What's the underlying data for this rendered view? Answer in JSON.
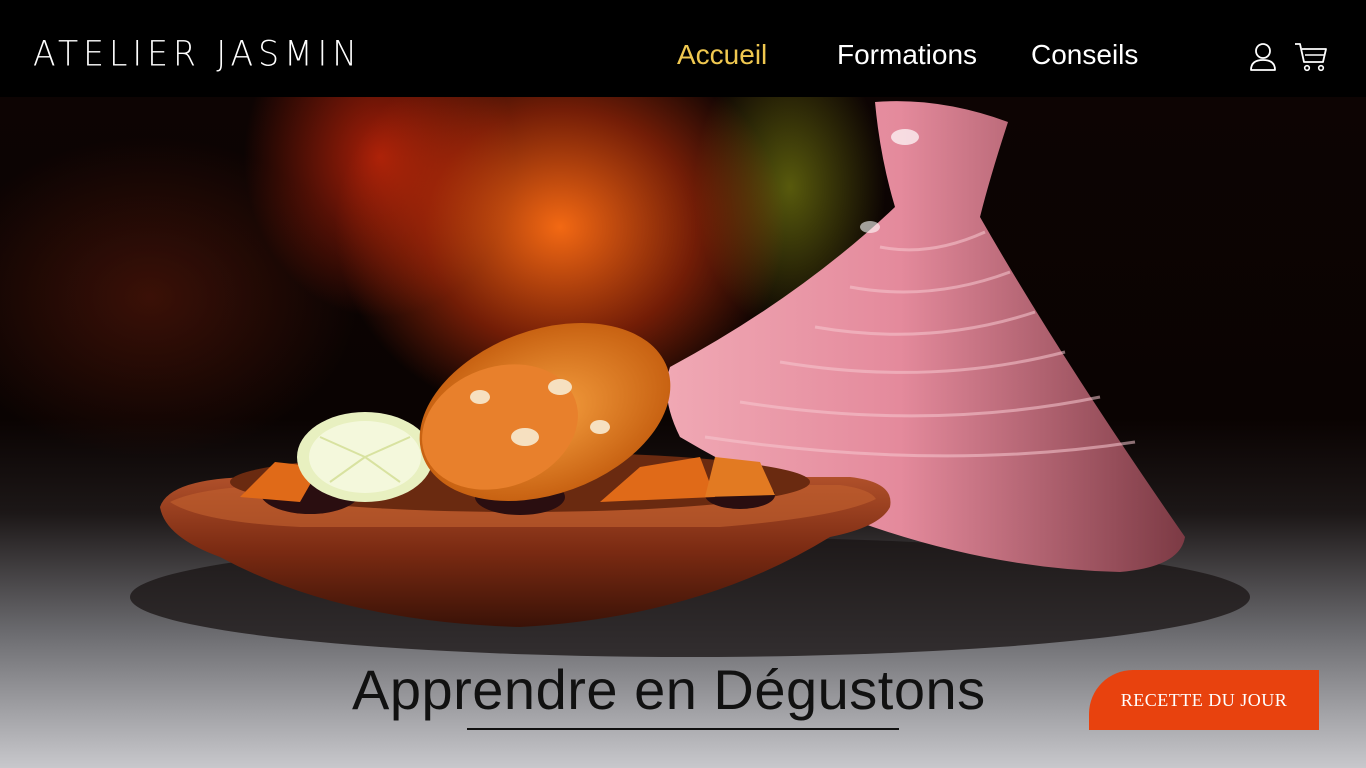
{
  "header": {
    "logo": "ATELIER JASMIN",
    "nav": [
      {
        "label": "Accueil",
        "active": true
      },
      {
        "label": "Formations",
        "active": false
      },
      {
        "label": "Conseils",
        "active": false
      }
    ],
    "icons": [
      "user-icon",
      "cart-icon"
    ],
    "active_color": "#f0c850"
  },
  "hero": {
    "image": "tajine-dish-photo",
    "title": "Apprendre en Dégustons",
    "cta_label": "RECETTE DU JOUR",
    "cta_color": "#e8420e"
  }
}
